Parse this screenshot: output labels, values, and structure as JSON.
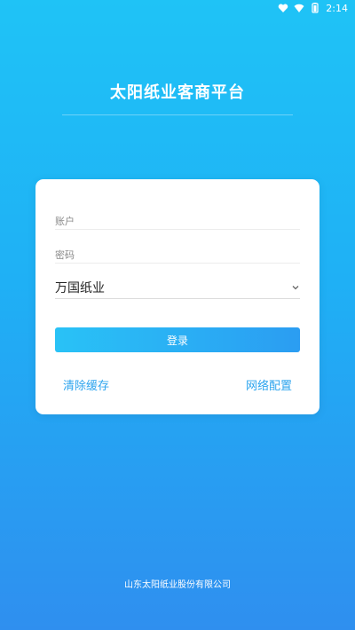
{
  "status_bar": {
    "time": "2:14",
    "icons": [
      "heart-icon",
      "wifi-icon",
      "battery-icon"
    ]
  },
  "header": {
    "title": "太阳纸业客商平台"
  },
  "form": {
    "account_placeholder": "账户",
    "password_placeholder": "密码",
    "company_select_value": "万国纸业",
    "login_label": "登录"
  },
  "links": {
    "clear_cache": "清除缓存",
    "network_config": "网络配置"
  },
  "footer": {
    "company": "山东太阳纸业股份有限公司"
  },
  "colors": {
    "background_top": "#1fc3f6",
    "background_bottom": "#2f8fef",
    "accent": "#2ca4ee"
  }
}
